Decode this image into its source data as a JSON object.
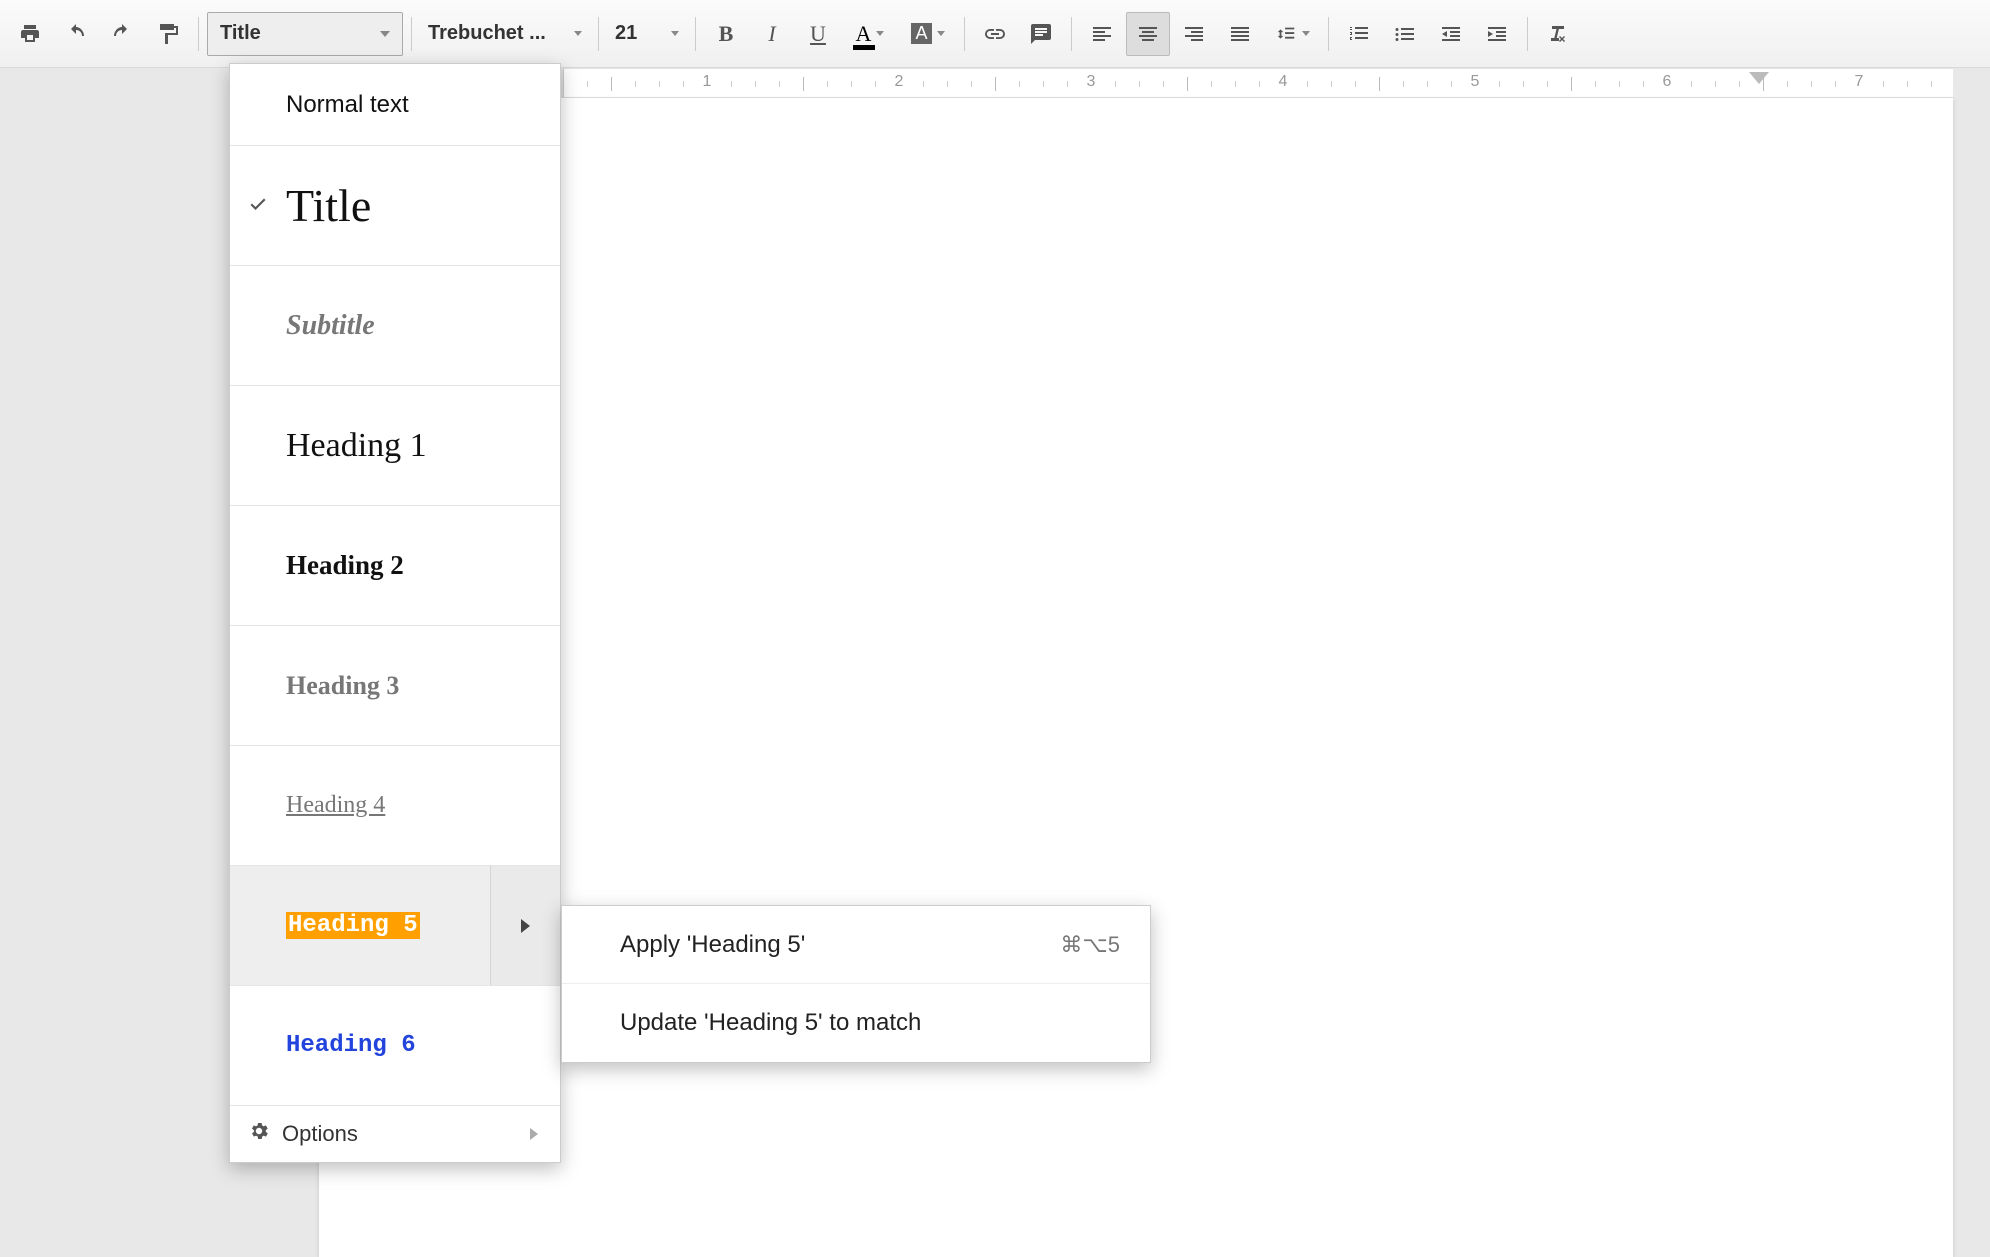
{
  "toolbar": {
    "styles_label": "Title",
    "font_label": "Trebuchet ...",
    "size_label": "21"
  },
  "ruler": {
    "numbers": [
      1,
      2,
      3,
      4,
      5,
      6,
      7
    ]
  },
  "styles_menu": {
    "items": [
      {
        "label": "Normal text",
        "cls": "style-normal",
        "checked": false
      },
      {
        "label": "Title",
        "cls": "style-title",
        "checked": true
      },
      {
        "label": "Subtitle",
        "cls": "style-subtitle",
        "checked": false
      },
      {
        "label": "Heading 1",
        "cls": "style-h1",
        "checked": false
      },
      {
        "label": "Heading 2",
        "cls": "style-h2",
        "checked": false
      },
      {
        "label": "Heading 3",
        "cls": "style-h3",
        "checked": false
      },
      {
        "label": "Heading 4",
        "cls": "style-h4",
        "checked": false
      },
      {
        "label": "Heading 5",
        "cls": "style-h5",
        "checked": false,
        "hov": true
      },
      {
        "label": "Heading 6",
        "cls": "style-h6",
        "checked": false
      }
    ],
    "options_label": "Options"
  },
  "submenu": {
    "apply_label": "Apply 'Heading 5'",
    "apply_shortcut": "⌘⌥5",
    "update_label": "Update 'Heading 5' to match"
  }
}
